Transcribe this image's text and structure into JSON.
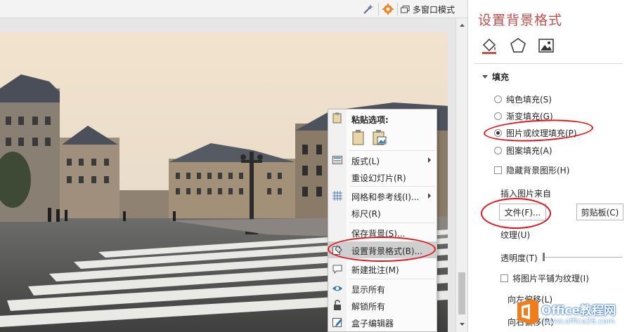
{
  "topbar": {
    "multi_window_label": "多窗口模式",
    "icons": [
      "magic-wand-icon",
      "gear-icon",
      "multi-window-icon"
    ]
  },
  "context_menu": {
    "paste_header": "粘贴选项:",
    "items": [
      {
        "label": "版式(L)",
        "icon": "layout-icon",
        "submenu": true
      },
      {
        "label": "重设幻灯片(R)",
        "icon": "",
        "submenu": false
      },
      {
        "label": "网格和参考线(I)...",
        "icon": "grid-icon",
        "submenu": true
      },
      {
        "label": "标尺(R)",
        "icon": "",
        "submenu": false
      },
      {
        "label": "保存背景(S)...",
        "icon": "",
        "submenu": false
      },
      {
        "label": "设置背景格式(B)...",
        "icon": "format-background-icon",
        "submenu": false
      },
      {
        "label": "新建批注(M)",
        "icon": "comment-icon",
        "submenu": false
      },
      {
        "label": "显示所有",
        "icon": "eye-icon",
        "submenu": false
      },
      {
        "label": "解锁所有",
        "icon": "unlock-icon",
        "submenu": false
      },
      {
        "label": "盒子编辑器",
        "icon": "edit-icon",
        "submenu": false
      }
    ]
  },
  "pane": {
    "title": "设置背景格式",
    "section": "填充",
    "fill_options": [
      {
        "label": "纯色填充(S)",
        "selected": false
      },
      {
        "label": "渐变填充(G)",
        "selected": false
      },
      {
        "label": "图片或纹理填充(P)",
        "selected": true
      },
      {
        "label": "图案填充(A)",
        "selected": false
      }
    ],
    "hide_bg_graphics": "隐藏背景图形(H)",
    "insert_from": "插入图片来自",
    "file_button": "文件(F)...",
    "clipboard_button": "剪贴板(C)",
    "texture_label": "纹理(U)",
    "transparency_label": "透明度(T)",
    "tile_label": "将图片平铺为纹理(I)",
    "offset_left": "向左偏移(L)",
    "offset_right": "向右偏移(R)"
  },
  "watermark": {
    "main": "Office教程网",
    "sub": "www.office26.com"
  },
  "colors": {
    "accent_red": "#c0504d",
    "annotation_red": "#e0141e",
    "watermark_orange": "#f07c1c",
    "watermark_blue": "#1565c0"
  }
}
